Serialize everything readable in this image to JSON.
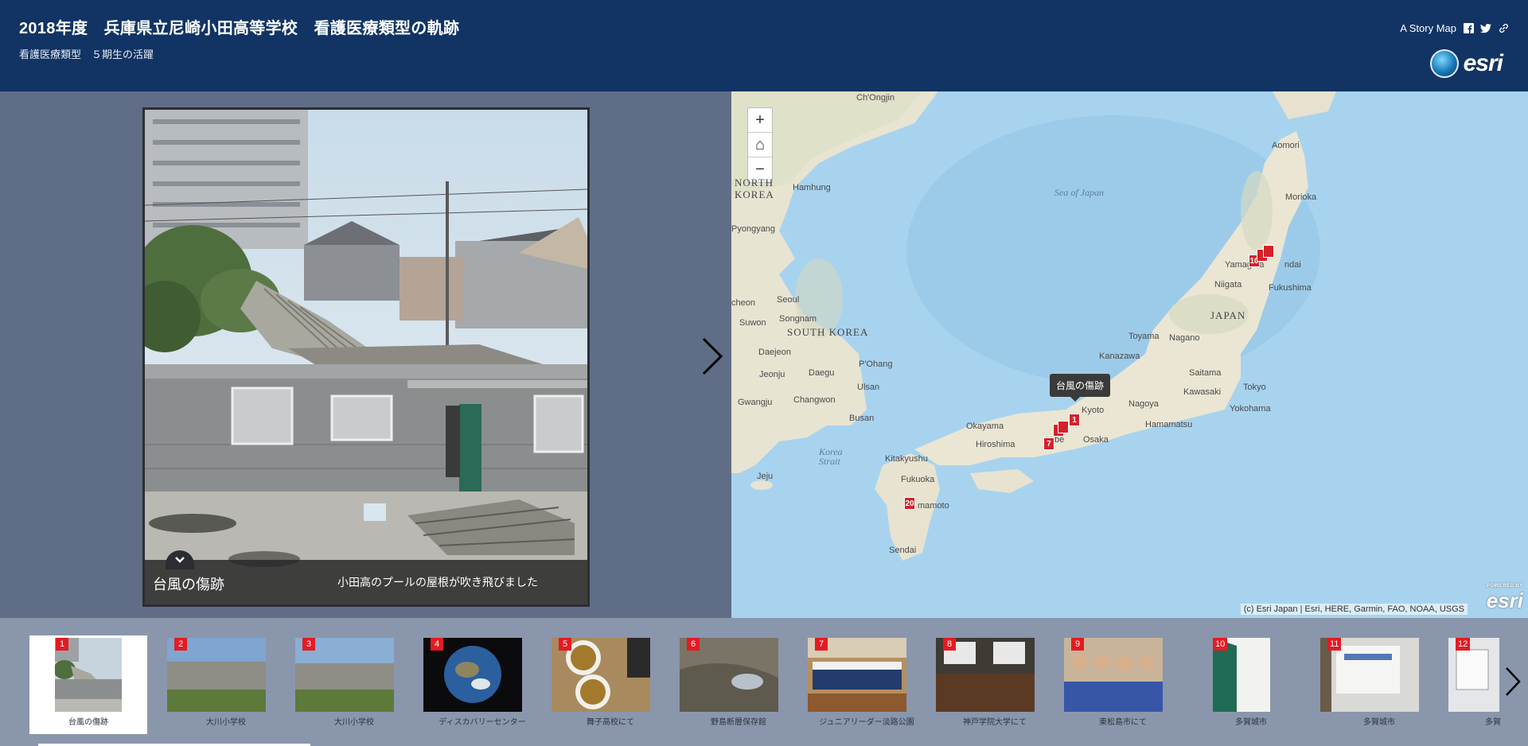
{
  "header": {
    "title": "2018年度　兵庫県立尼崎小田高等学校　看護医療類型の軌跡",
    "subtitle": "看護医療類型　５期生の活躍",
    "share_label": "A Story Map",
    "share_icons": [
      "facebook-icon",
      "twitter-icon",
      "link-icon"
    ],
    "logo_text": "esri"
  },
  "main_media": {
    "caption_title": "台風の傷跡",
    "caption_text": "小田高のプールの屋根が吹き飛びました"
  },
  "map": {
    "tooltip": "台風の傷跡",
    "attribution": "(c) Esri Japan | Esri, HERE, Garmin, FAO, NOAA, USGS",
    "powered_small": "POWERED BY",
    "powered_text": "esri",
    "sea_labels": {
      "sea_of_japan": "Sea of Japan",
      "korea_strait": "Korea Strait"
    },
    "countries": {
      "north_korea": "NORTH KOREA",
      "south_korea": "SOUTH KOREA",
      "japan": "JAPAN"
    },
    "cities": {
      "chongjin": "Ch'Ongjin",
      "hamhung": "Hamhung",
      "pyongyang": "Pyongyang",
      "seoul": "Seoul",
      "suwon": "Suwon",
      "songnam": "Songnam",
      "cheon": "cheon",
      "daejeon": "Daejeon",
      "jeonju": "Jeonju",
      "daegu": "Daegu",
      "pohang": "P'Ohang",
      "ulsan": "Ulsan",
      "gwangju": "Gwangju",
      "changwon": "Changwon",
      "busan": "Busan",
      "jeju": "Jeju",
      "kitakyushu": "Kitakyushu",
      "fukuoka": "Fukuoka",
      "kumamoto": "mamoto",
      "sendai_k": "Sendai",
      "hiroshima": "Hiroshima",
      "okayama": "Okayama",
      "kobe": "be",
      "osaka": "Osaka",
      "kyoto": "Kyoto",
      "nagoya": "Nagoya",
      "hamamatsu": "Hamamatsu",
      "toyama": "Toyama",
      "nagano": "Nagano",
      "kanazawa": "Kanazawa",
      "saitama": "Saitama",
      "kawasaki": "Kawasaki",
      "tokyo": "Tokyo",
      "yokohama": "Yokohama",
      "niigata": "Niigata",
      "yamagata": "Yamagata",
      "sendai": "ndai",
      "fukushima": "Fukushima",
      "morioka": "Morioka",
      "aomori": "Aomori"
    },
    "markers": [
      "1",
      "7",
      "20",
      "10"
    ],
    "zoom": {
      "in": "+",
      "home": "⌂",
      "out": "−"
    }
  },
  "thumbnails": [
    {
      "num": "1",
      "label": "台風の傷跡"
    },
    {
      "num": "2",
      "label": "大川小学校"
    },
    {
      "num": "3",
      "label": "大川小学校"
    },
    {
      "num": "4",
      "label": "ディスカバリーセンター"
    },
    {
      "num": "5",
      "label": "舞子高校にて"
    },
    {
      "num": "6",
      "label": "野島断層保存館"
    },
    {
      "num": "7",
      "label": "ジュニアリーダー淡路公園"
    },
    {
      "num": "8",
      "label": "神戸学院大学にて"
    },
    {
      "num": "9",
      "label": "東松島市にて"
    },
    {
      "num": "10",
      "label": "多賀城市"
    },
    {
      "num": "11",
      "label": "多賀城市"
    },
    {
      "num": "12",
      "label": "多賀"
    }
  ]
}
